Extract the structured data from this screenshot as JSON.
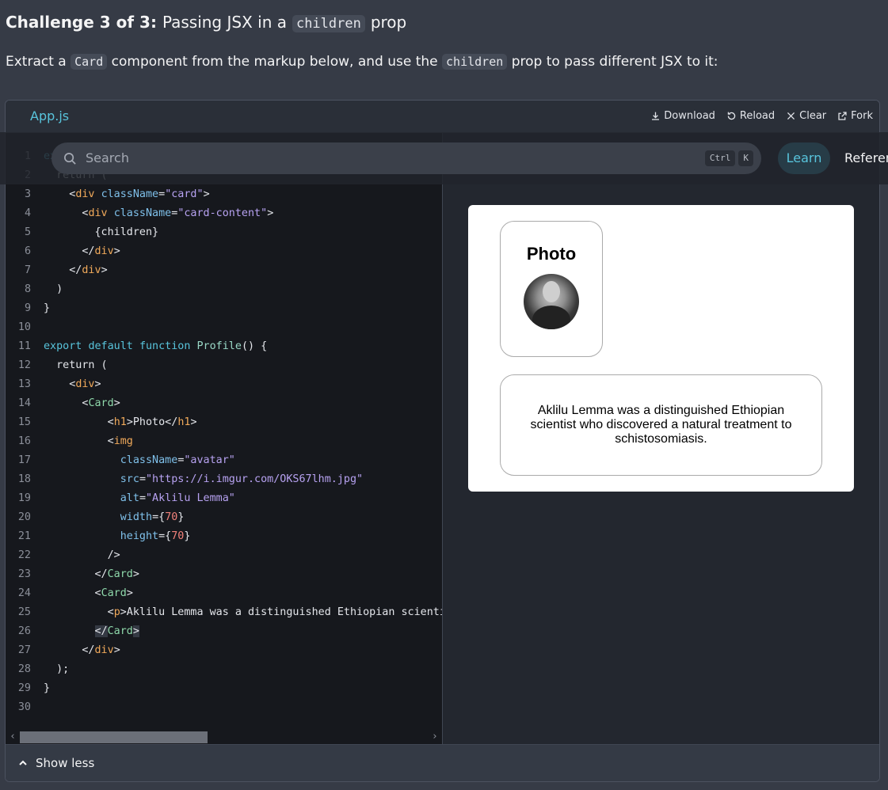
{
  "challenge": {
    "prefix": "Challenge 3 of 3:",
    "title_before": "Passing JSX in a",
    "title_code": "children",
    "title_after": "prop"
  },
  "intro": {
    "part1": "Extract a",
    "code1": "Card",
    "part2": "component from the markup below, and use the",
    "code2": "children",
    "part3": "prop to pass different JSX to it:"
  },
  "sandbox": {
    "file_tab": "App.js",
    "actions": {
      "download": "Download",
      "reload": "Reload",
      "clear": "Clear",
      "fork": "Fork"
    },
    "code_lines": [
      [
        {
          "t": "export ",
          "c": "k"
        },
        {
          "t": "function ",
          "c": "k"
        },
        {
          "t": "Card",
          "c": "f"
        },
        {
          "t": "({children}) {",
          "c": "p"
        }
      ],
      [
        {
          "t": "  return (",
          "c": "p"
        }
      ],
      [
        {
          "t": "    <",
          "c": "p"
        },
        {
          "t": "div",
          "c": "t"
        },
        {
          "t": " ",
          "c": "p"
        },
        {
          "t": "className",
          "c": "a"
        },
        {
          "t": "=",
          "c": "p"
        },
        {
          "t": "\"card\"",
          "c": "s"
        },
        {
          "t": ">",
          "c": "p"
        }
      ],
      [
        {
          "t": "      <",
          "c": "p"
        },
        {
          "t": "div",
          "c": "t"
        },
        {
          "t": " ",
          "c": "p"
        },
        {
          "t": "className",
          "c": "a"
        },
        {
          "t": "=",
          "c": "p"
        },
        {
          "t": "\"card-content\"",
          "c": "s"
        },
        {
          "t": ">",
          "c": "p"
        }
      ],
      [
        {
          "t": "        {children}",
          "c": "p"
        }
      ],
      [
        {
          "t": "      </",
          "c": "p"
        },
        {
          "t": "div",
          "c": "t"
        },
        {
          "t": ">",
          "c": "p"
        }
      ],
      [
        {
          "t": "    </",
          "c": "p"
        },
        {
          "t": "div",
          "c": "t"
        },
        {
          "t": ">",
          "c": "p"
        }
      ],
      [
        {
          "t": "  )",
          "c": "p"
        }
      ],
      [
        {
          "t": "}",
          "c": "p"
        }
      ],
      [],
      [
        {
          "t": "export ",
          "c": "k"
        },
        {
          "t": "default ",
          "c": "k"
        },
        {
          "t": "function ",
          "c": "k"
        },
        {
          "t": "Profile",
          "c": "f"
        },
        {
          "t": "() {",
          "c": "p"
        }
      ],
      [
        {
          "t": "  return (",
          "c": "p"
        }
      ],
      [
        {
          "t": "    <",
          "c": "p"
        },
        {
          "t": "div",
          "c": "t"
        },
        {
          "t": ">",
          "c": "p"
        }
      ],
      [
        {
          "t": "      <",
          "c": "p"
        },
        {
          "t": "Card",
          "c": "c"
        },
        {
          "t": ">",
          "c": "p"
        }
      ],
      [
        {
          "t": "          <",
          "c": "p"
        },
        {
          "t": "h1",
          "c": "t"
        },
        {
          "t": ">Photo</",
          "c": "p"
        },
        {
          "t": "h1",
          "c": "t"
        },
        {
          "t": ">",
          "c": "p"
        }
      ],
      [
        {
          "t": "          <",
          "c": "p"
        },
        {
          "t": "img",
          "c": "t"
        }
      ],
      [
        {
          "t": "            ",
          "c": "p"
        },
        {
          "t": "className",
          "c": "a"
        },
        {
          "t": "=",
          "c": "p"
        },
        {
          "t": "\"avatar\"",
          "c": "s"
        }
      ],
      [
        {
          "t": "            ",
          "c": "p"
        },
        {
          "t": "src",
          "c": "a"
        },
        {
          "t": "=",
          "c": "p"
        },
        {
          "t": "\"https://i.imgur.com/OKS67lhm.jpg\"",
          "c": "s"
        }
      ],
      [
        {
          "t": "            ",
          "c": "p"
        },
        {
          "t": "alt",
          "c": "a"
        },
        {
          "t": "=",
          "c": "p"
        },
        {
          "t": "\"Aklilu Lemma\"",
          "c": "s"
        }
      ],
      [
        {
          "t": "            ",
          "c": "p"
        },
        {
          "t": "width",
          "c": "a"
        },
        {
          "t": "={",
          "c": "p"
        },
        {
          "t": "70",
          "c": "n"
        },
        {
          "t": "}",
          "c": "p"
        }
      ],
      [
        {
          "t": "            ",
          "c": "p"
        },
        {
          "t": "height",
          "c": "a"
        },
        {
          "t": "={",
          "c": "p"
        },
        {
          "t": "70",
          "c": "n"
        },
        {
          "t": "}",
          "c": "p"
        }
      ],
      [
        {
          "t": "          />",
          "c": "p"
        }
      ],
      [
        {
          "t": "        </",
          "c": "p"
        },
        {
          "t": "Card",
          "c": "c"
        },
        {
          "t": ">",
          "c": "p"
        }
      ],
      [
        {
          "t": "        <",
          "c": "p"
        },
        {
          "t": "Card",
          "c": "c"
        },
        {
          "t": ">",
          "c": "p"
        }
      ],
      [
        {
          "t": "          <",
          "c": "p"
        },
        {
          "t": "p",
          "c": "t"
        },
        {
          "t": ">Aklilu Lemma was a distinguished Ethiopian scientist who discovered a natural treatment to schistosomiasis.</",
          "c": "p"
        },
        {
          "t": "p",
          "c": "t"
        },
        {
          "t": ">",
          "c": "p"
        }
      ],
      [
        {
          "t": "        ",
          "c": "p"
        },
        {
          "t": "</",
          "c": "p",
          "hl": true
        },
        {
          "t": "Card",
          "c": "c"
        },
        {
          "t": ">",
          "c": "p",
          "hl": true
        }
      ],
      [
        {
          "t": "      </",
          "c": "p"
        },
        {
          "t": "div",
          "c": "t"
        },
        {
          "t": ">",
          "c": "p"
        }
      ],
      [
        {
          "t": "  );",
          "c": "p"
        }
      ],
      [
        {
          "t": "}",
          "c": "p"
        }
      ],
      []
    ],
    "show_less": "Show less"
  },
  "preview": {
    "photo_heading": "Photo",
    "avatar_alt": "Aklilu Lemma",
    "bio": "Aklilu Lemma was a distinguished Ethiopian scientist who discovered a natural treatment to schistosomiasis."
  },
  "topnav": {
    "search_placeholder": "Search",
    "kbd_ctrl": "Ctrl",
    "kbd_k": "K",
    "learn": "Learn",
    "reference": "Reference"
  },
  "colors": {
    "accent": "#58c4dc",
    "page_bg": "#363b46",
    "editor_bg": "#16181d"
  }
}
